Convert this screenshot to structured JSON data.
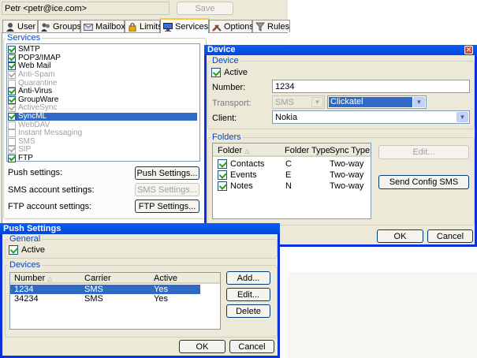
{
  "top": {
    "user_field": "Petr <petr@ice.com>",
    "save_label": "Save"
  },
  "tabs": [
    {
      "label": "User",
      "icon": "user-icon"
    },
    {
      "label": "Groups",
      "icon": "groups-icon"
    },
    {
      "label": "Mailbox",
      "icon": "mailbox-icon"
    },
    {
      "label": "Limits",
      "icon": "lock-icon"
    },
    {
      "label": "Services",
      "icon": "services-icon"
    },
    {
      "label": "Options",
      "icon": "tools-icon"
    },
    {
      "label": "Rules",
      "icon": "filter-icon"
    }
  ],
  "services": {
    "legend": "Services",
    "items": [
      {
        "label": "SMTP",
        "checked": true,
        "enabled": true
      },
      {
        "label": "POP3/IMAP",
        "checked": true,
        "enabled": true
      },
      {
        "label": "Web Mail",
        "checked": true,
        "enabled": true
      },
      {
        "label": "Anti-Spam",
        "checked": true,
        "enabled": false
      },
      {
        "label": "Quarantine",
        "checked": false,
        "enabled": false
      },
      {
        "label": "Anti-Virus",
        "checked": true,
        "enabled": true
      },
      {
        "label": "GroupWare",
        "checked": true,
        "enabled": true
      },
      {
        "label": "ActiveSync",
        "checked": true,
        "enabled": false
      },
      {
        "label": "SyncML",
        "checked": true,
        "enabled": true,
        "selected": true
      },
      {
        "label": "WebDAV",
        "checked": false,
        "enabled": false
      },
      {
        "label": "Instant Messaging",
        "checked": false,
        "enabled": false
      },
      {
        "label": "SMS",
        "checked": false,
        "enabled": false
      },
      {
        "label": "SIP",
        "checked": true,
        "enabled": false
      },
      {
        "label": "FTP",
        "checked": true,
        "enabled": true
      }
    ],
    "push_label": "Push settings:",
    "push_button": "Push Settings...",
    "sms_label": "SMS account settings:",
    "sms_button": "SMS Settings...",
    "ftp_label": "FTP account settings:",
    "ftp_button": "FTP Settings..."
  },
  "device": {
    "title": "Device",
    "legend": "Device",
    "active_label": "Active",
    "active_checked": true,
    "number_label": "Number:",
    "number_value": "1234",
    "transport_label": "Transport:",
    "transport_value": "SMS",
    "provider_value": "Clickatel",
    "client_label": "Client:",
    "client_value": "Nokia",
    "folders_legend": "Folders",
    "folders_columns": [
      "Folder",
      "Folder Type",
      "Sync Type"
    ],
    "folders": [
      {
        "name": "Contacts",
        "type": "C",
        "sync": "Two-way",
        "checked": true
      },
      {
        "name": "Events",
        "type": "E",
        "sync": "Two-way",
        "checked": true
      },
      {
        "name": "Notes",
        "type": "N",
        "sync": "Two-way",
        "checked": true
      }
    ],
    "edit_button": "Edit...",
    "send_config_button": "Send Config SMS",
    "ok_button": "OK",
    "cancel_button": "Cancel"
  },
  "push": {
    "title": "Push Settings",
    "general_legend": "General",
    "active_label": "Active",
    "active_checked": true,
    "devices_legend": "Devices",
    "columns": [
      "Number",
      "Carrier",
      "Active"
    ],
    "rows": [
      {
        "number": "1234",
        "carrier": "SMS",
        "active": "Yes",
        "selected": true
      },
      {
        "number": "34234",
        "carrier": "SMS",
        "active": "Yes",
        "selected": false
      }
    ],
    "add_button": "Add...",
    "edit_button": "Edit...",
    "delete_button": "Delete",
    "ok_button": "OK",
    "cancel_button": "Cancel"
  }
}
